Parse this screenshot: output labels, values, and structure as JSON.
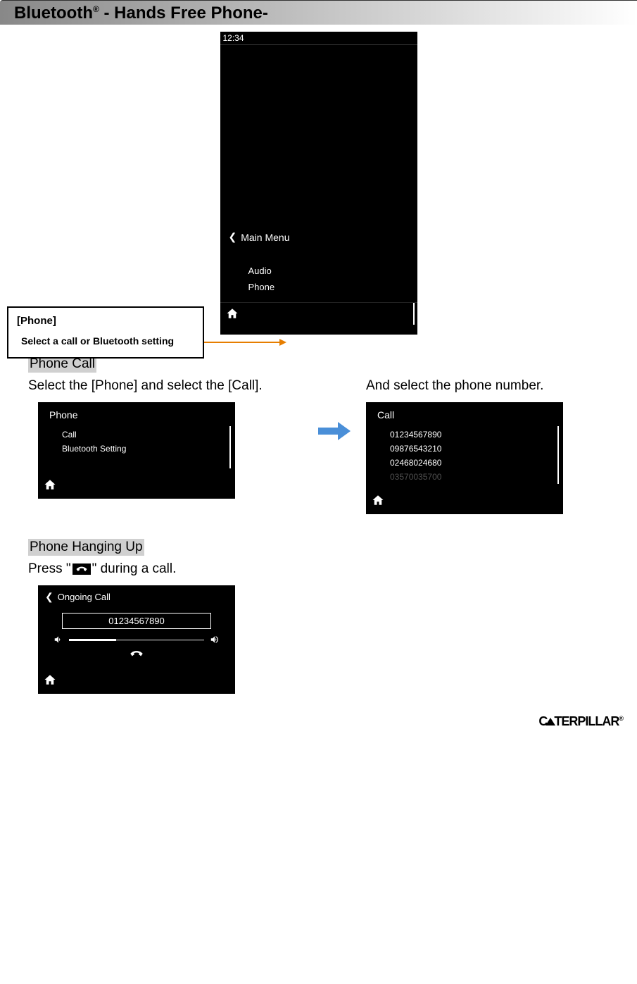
{
  "title": {
    "main": "Bluetooth",
    "suffix": "  - Hands Free Phone-"
  },
  "main_menu": {
    "time": "12:34",
    "header": "Main Menu",
    "items": [
      "Audio",
      "Phone"
    ]
  },
  "callout": {
    "label": "[Phone]",
    "text": "Select a call or Bluetooth setting"
  },
  "phone_call": {
    "heading": "Phone Call",
    "instruction_left": "Select the [Phone] and select the [Call].",
    "instruction_right": "And select the phone number.",
    "phone_screen": {
      "header": "Phone",
      "items": [
        "Call",
        "Bluetooth Setting"
      ]
    },
    "call_screen": {
      "header": "Call",
      "items": [
        "01234567890",
        "09876543210",
        "02468024680",
        "03570035700"
      ]
    }
  },
  "hangup": {
    "heading": "Phone Hanging Up",
    "instruction_prefix": "Press \"",
    "instruction_suffix": "\" during a call.",
    "ongoing": {
      "header": "Ongoing Call",
      "number": "01234567890"
    }
  },
  "footer": {
    "brand_left": "C",
    "brand_right": "TERPILLAR"
  }
}
